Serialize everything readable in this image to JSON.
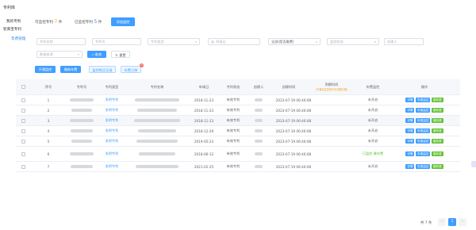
{
  "sidebar": {
    "title": "专利库",
    "items": [
      {
        "label": "我的专利",
        "active": false
      },
      {
        "label": "智库宝专利",
        "active": false
      },
      {
        "label": "年费管理",
        "active": true
      }
    ]
  },
  "header": {
    "monitorable_label": "可监控专利",
    "monitorable_count": "7",
    "monitored_label": "已监控专利",
    "monitored_count": "5",
    "unit": "件",
    "renew_button": "添加监控"
  },
  "filters": {
    "patent_name": "专利名称",
    "patent_no": "专利号",
    "patent_type": "专利类型",
    "apply_date": "申请日",
    "status": "全部(是否缴费)",
    "monitor_status": "监控状态",
    "creator": "创建人",
    "source": "数据来源",
    "search": "查询",
    "reset": "重置"
  },
  "toolbar": {
    "open_monitor": "开通监控",
    "batch_pay": "缴纳年费",
    "cancel_monitor": "监控购买记录",
    "fee_order": "年费订单",
    "fee_order_badge": "0"
  },
  "table": {
    "headers": [
      "序号",
      "专利号",
      "专利类型",
      "专利名称",
      "申请日",
      "专利状态",
      "创建人",
      "创建时间",
      "到期时间",
      "年费监控",
      "操作"
    ],
    "due_note": "(不满足监控条件无到期日期)",
    "rows": [
      {
        "no": "1",
        "type": "发明专利",
        "date": "2018-11-23",
        "status": "有效专利",
        "created": "2023-07-19 06:46:08",
        "monitor": "未开启",
        "actions": [
          "详情",
          "年费监控",
          "缴年费"
        ]
      },
      {
        "no": "2",
        "type": "发明专利",
        "date": "2018-11-23",
        "status": "有效专利",
        "created": "2023-07-19 06:46:08",
        "monitor": "未开启",
        "actions": [
          "详情",
          "年费监控",
          "缴年费"
        ]
      },
      {
        "no": "3",
        "type": "发明专利",
        "date": "2018-11-23",
        "status": "有效专利",
        "created": "2023-07-19 06:46:08",
        "monitor": "未开启",
        "actions": [
          "详情",
          "年费监控",
          "缴年费"
        ]
      },
      {
        "no": "4",
        "type": "发明专利",
        "date": "2018-12-29",
        "status": "有效专利",
        "created": "2023-07-19 06:46:08",
        "monitor": "未开启",
        "actions": [
          "详情",
          "年费监控",
          "缴年费"
        ]
      },
      {
        "no": "5",
        "type": "发明专利",
        "date": "2019-05-23",
        "status": "有效专利",
        "created": "2023-07-19 06:46:08",
        "monitor": "未开启",
        "actions": [
          "详情",
          "年费监控",
          "缴年费"
        ]
      },
      {
        "no": "6",
        "type": "发明专利",
        "date": "2018-06-12",
        "status": "有效专利",
        "created": "2023-07-19 06:46:08",
        "monitor": "已监控 缴年费",
        "actions": [
          "详情",
          "年费监控",
          "缴年费"
        ]
      },
      {
        "no": "7",
        "type": "发明专利",
        "date": "2021-02-25",
        "status": "有效专利",
        "created": "2023-07-19 06:46:08",
        "monitor": "未开启",
        "actions": [
          "详情",
          "年费监控",
          "缴年费"
        ]
      }
    ]
  },
  "pagination": {
    "total": "共 7 条",
    "page": "1",
    "prev": "<",
    "next": ">"
  },
  "colors": {
    "primary": "#409eff",
    "success": "#67c23a",
    "warning": "#f5a623"
  }
}
